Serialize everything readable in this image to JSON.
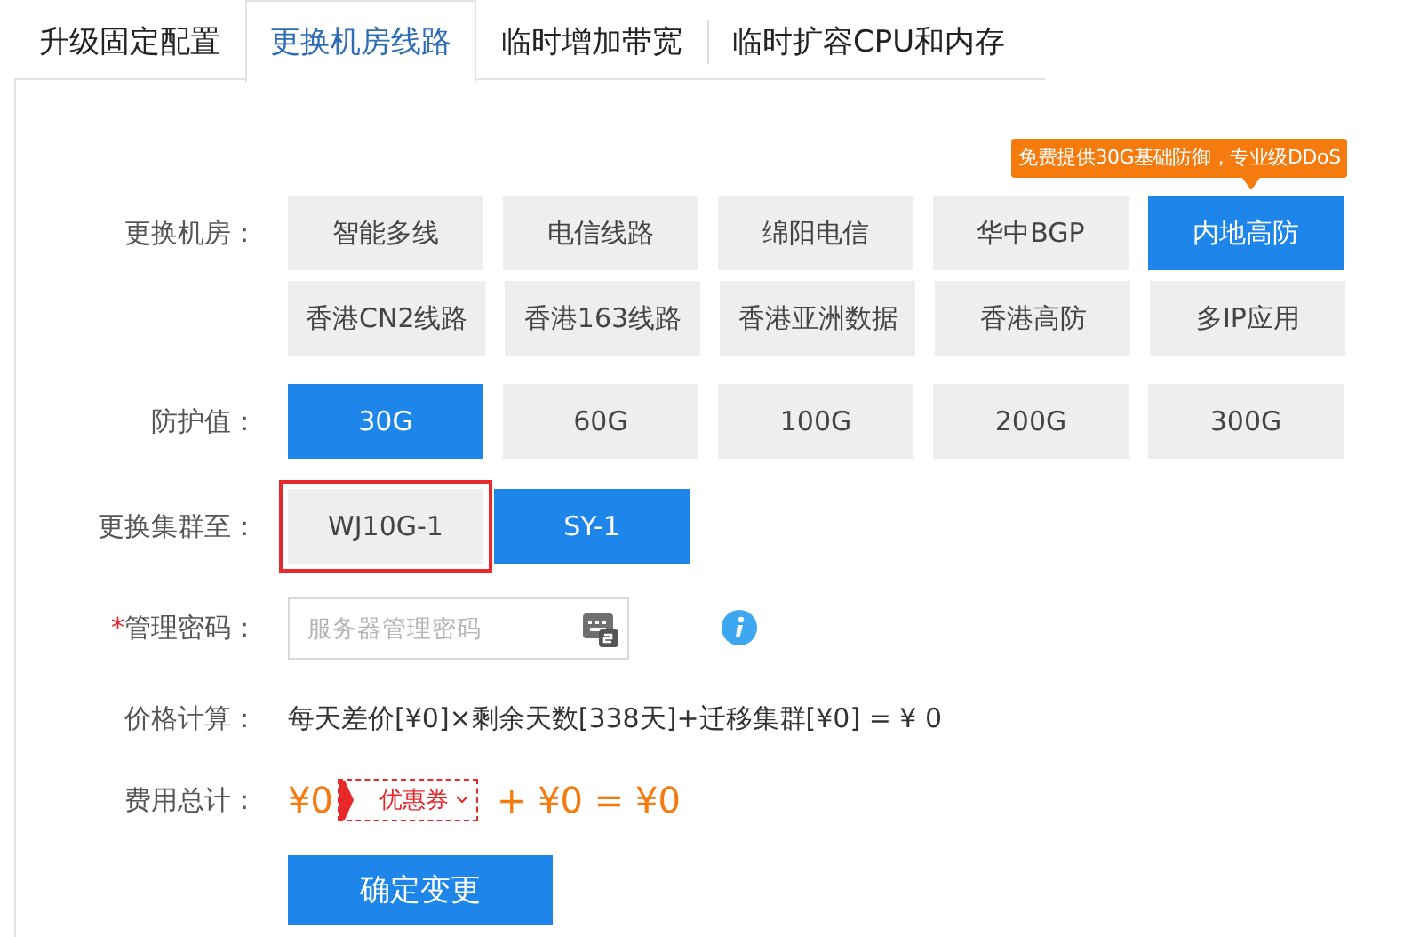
{
  "tabs": [
    {
      "label": "升级固定配置",
      "selected": false
    },
    {
      "label": "更换机房线路",
      "selected": true
    },
    {
      "label": "临时增加带宽",
      "selected": false
    },
    {
      "label": "临时扩容CPU和内存",
      "selected": false
    }
  ],
  "tooltip": {
    "text": "免费提供30G基础防御，专业级DDoS"
  },
  "datacenter": {
    "label": "更换机房：",
    "options": [
      {
        "label": "智能多线",
        "selected": false
      },
      {
        "label": "电信线路",
        "selected": false
      },
      {
        "label": "绵阳电信",
        "selected": false
      },
      {
        "label": "华中BGP",
        "selected": false
      },
      {
        "label": "内地高防",
        "selected": true
      },
      {
        "label": "香港CN2线路",
        "selected": false
      },
      {
        "label": "香港163线路",
        "selected": false
      },
      {
        "label": "香港亚洲数据",
        "selected": false
      },
      {
        "label": "香港高防",
        "selected": false
      },
      {
        "label": "多IP应用",
        "selected": false
      }
    ]
  },
  "protection": {
    "label": "防护值：",
    "options": [
      {
        "label": "30G",
        "selected": true
      },
      {
        "label": "60G",
        "selected": false
      },
      {
        "label": "100G",
        "selected": false
      },
      {
        "label": "200G",
        "selected": false
      },
      {
        "label": "300G",
        "selected": false
      }
    ]
  },
  "cluster": {
    "label": "更换集群至：",
    "options": [
      {
        "label": "WJ10G-1",
        "selected": false,
        "highlighted": true
      },
      {
        "label": "SY-1",
        "selected": true,
        "highlighted": false
      }
    ]
  },
  "password": {
    "required_mark": "*",
    "label": "管理密码：",
    "placeholder": "服务器管理密码"
  },
  "price": {
    "label": "价格计算：",
    "formula": "每天差价[¥0]×剩余天数[338天]+迁移集群[¥0] = ¥ 0"
  },
  "total": {
    "label": "费用总计：",
    "amount": "¥0",
    "coupon": "优惠券",
    "rest": "+ ¥0 = ¥0"
  },
  "submit": "确定变更"
}
